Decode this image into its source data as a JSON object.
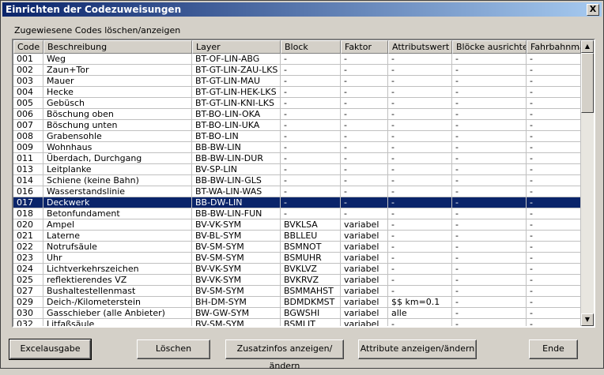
{
  "window": {
    "title": "Einrichten der Codezuweisungen",
    "close_symbol": "X"
  },
  "group_label": "Zugewiesene Codes löschen/anzeigen",
  "columns": [
    "Code",
    "Beschreibung",
    "Layer",
    "Block",
    "Faktor",
    "Attributswert",
    "Blöcke ausrichten",
    "Fahrbahnmark."
  ],
  "rows": [
    [
      "001",
      "Weg",
      "BT-OF-LIN-ABG",
      "-",
      "-",
      "-",
      "-",
      "-"
    ],
    [
      "002",
      "Zaun+Tor",
      "BT-GT-LIN-ZAU-LKS",
      "-",
      "-",
      "-",
      "-",
      "-"
    ],
    [
      "003",
      "Mauer",
      "BT-GT-LIN-MAU",
      "-",
      "-",
      "-",
      "-",
      "-"
    ],
    [
      "004",
      "Hecke",
      "BT-GT-LIN-HEK-LKS",
      "-",
      "-",
      "-",
      "-",
      "-"
    ],
    [
      "005",
      "Gebüsch",
      "BT-GT-LIN-KNI-LKS",
      "-",
      "-",
      "-",
      "-",
      "-"
    ],
    [
      "006",
      "Böschung oben",
      "BT-BO-LIN-OKA",
      "-",
      "-",
      "-",
      "-",
      "-"
    ],
    [
      "007",
      "Böschung unten",
      "BT-BO-LIN-UKA",
      "-",
      "-",
      "-",
      "-",
      "-"
    ],
    [
      "008",
      "Grabensohle",
      "BT-BO-LIN",
      "-",
      "-",
      "-",
      "-",
      "-"
    ],
    [
      "009",
      "Wohnhaus",
      "BB-BW-LIN",
      "-",
      "-",
      "-",
      "-",
      "-"
    ],
    [
      "011",
      "Überdach, Durchgang",
      "BB-BW-LIN-DUR",
      "-",
      "-",
      "-",
      "-",
      "-"
    ],
    [
      "013",
      "Leitplanke",
      "BV-SP-LIN",
      "-",
      "-",
      "-",
      "-",
      "-"
    ],
    [
      "014",
      "Schiene (keine Bahn)",
      "BB-BW-LIN-GLS",
      "-",
      "-",
      "-",
      "-",
      "-"
    ],
    [
      "016",
      "Wasserstandslinie",
      "BT-WA-LIN-WAS",
      "-",
      "-",
      "-",
      "-",
      "-"
    ],
    [
      "017",
      "Deckwerk",
      "BB-DW-LIN",
      "-",
      "-",
      "-",
      "-",
      "-"
    ],
    [
      "018",
      "Betonfundament",
      "BB-BW-LIN-FUN",
      "-",
      "-",
      "-",
      "-",
      "-"
    ],
    [
      "020",
      "Ampel",
      "BV-VK-SYM",
      "BVKLSA",
      "variabel",
      "-",
      "-",
      "-"
    ],
    [
      "021",
      "Laterne",
      "BV-BL-SYM",
      "BBLLEU",
      "variabel",
      "-",
      "-",
      "-"
    ],
    [
      "022",
      "Notrufsäule",
      "BV-SM-SYM",
      "BSMNOT",
      "variabel",
      "-",
      "-",
      "-"
    ],
    [
      "023",
      "Uhr",
      "BV-SM-SYM",
      "BSMUHR",
      "variabel",
      "-",
      "-",
      "-"
    ],
    [
      "024",
      "Lichtverkehrszeichen",
      "BV-VK-SYM",
      "BVKLVZ",
      "variabel",
      "-",
      "-",
      "-"
    ],
    [
      "025",
      "reflektierendes VZ",
      "BV-VK-SYM",
      "BVKRVZ",
      "variabel",
      "-",
      "-",
      "-"
    ],
    [
      "027",
      "Bushaltestellenmast",
      "BV-SM-SYM",
      "BSMMAHST",
      "variabel",
      "-",
      "-",
      "-"
    ],
    [
      "029",
      "Deich-/Kilometerstein",
      "BH-DM-SYM",
      "BDMDKMST",
      "variabel",
      "$$ km=0.1",
      "-",
      "-"
    ],
    [
      "030",
      "Gasschieber (alle Anbieter)",
      "BW-GW-SYM",
      "BGWSHI",
      "variabel",
      "alle",
      "-",
      "-"
    ],
    [
      "032",
      "Litfaßsäule",
      "BV-SM-SYM",
      "BSMLIT",
      "variabel",
      "-",
      "-",
      "-"
    ]
  ],
  "selected_row_index": 13,
  "buttons": {
    "excel": "Excelausgabe",
    "delete": "Löschen",
    "extra": "Zusatzinfos anzeigen/ändern",
    "attributes": "Attribute anzeigen/ändern",
    "end": "Ende"
  },
  "scroll": {
    "up_icon": "scroll-up-arrow",
    "down_icon": "scroll-down-arrow",
    "up_glyph": "▲",
    "down_glyph": "▼"
  },
  "colors": {
    "selection": "#0a246a",
    "title_start": "#0a246a",
    "title_end": "#a6caf0"
  }
}
